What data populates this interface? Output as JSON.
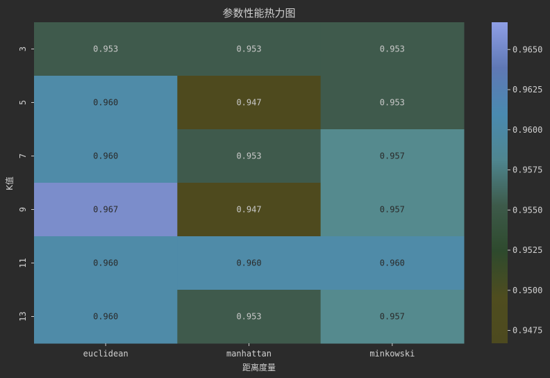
{
  "chart_data": {
    "type": "heatmap",
    "title": "参数性能热力图",
    "xlabel": "距离度量",
    "ylabel": "K值",
    "x_categories": [
      "euclidean",
      "manhattan",
      "minkowski"
    ],
    "y_categories": [
      "3",
      "5",
      "7",
      "9",
      "11",
      "13"
    ],
    "values": [
      [
        0.953,
        0.953,
        0.953
      ],
      [
        0.96,
        0.947,
        0.953
      ],
      [
        0.96,
        0.953,
        0.957
      ],
      [
        0.967,
        0.947,
        0.957
      ],
      [
        0.96,
        0.96,
        0.96
      ],
      [
        0.96,
        0.953,
        0.957
      ]
    ],
    "value_labels": [
      [
        "0.953",
        "0.953",
        "0.953"
      ],
      [
        "0.960",
        "0.947",
        "0.953"
      ],
      [
        "0.960",
        "0.953",
        "0.957"
      ],
      [
        "0.967",
        "0.947",
        "0.957"
      ],
      [
        "0.960",
        "0.960",
        "0.960"
      ],
      [
        "0.960",
        "0.953",
        "0.957"
      ]
    ],
    "colorbar": {
      "min": 0.9467,
      "max": 0.9667,
      "ticks": [
        0.9475,
        0.95,
        0.9525,
        0.955,
        0.9575,
        0.96,
        0.9625,
        0.965
      ],
      "tick_labels": [
        "0.9475",
        "0.9500",
        "0.9525",
        "0.9550",
        "0.9575",
        "0.9600",
        "0.9625",
        "0.9650"
      ],
      "colors": [
        "#4d4a1f",
        "#4f4d1f",
        "#2e4a2d",
        "#3d5a4a",
        "#4f8690",
        "#4a8ab0",
        "#5f78b5",
        "#8f9fe6"
      ]
    },
    "cell_colors": {
      "0.947": "#4e4a1e",
      "0.953": "#3f5a4c",
      "0.957": "#558a8e",
      "0.960": "#4f8ba8",
      "0.967": "#7b8dcb"
    },
    "text_color": "#c8c8c8",
    "dark_text_color": "#2a2a2a"
  }
}
